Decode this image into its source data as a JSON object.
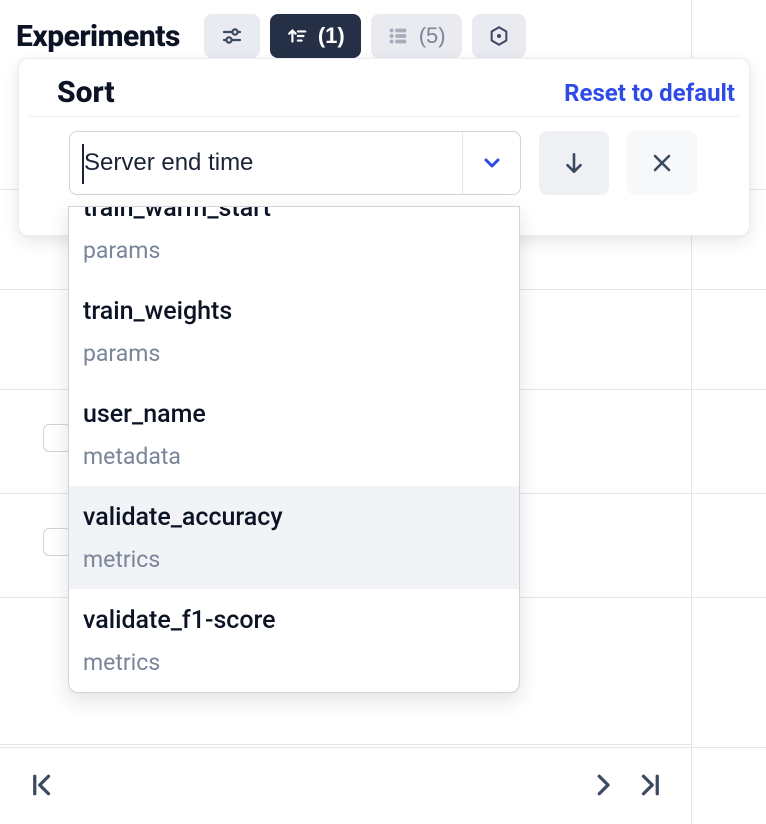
{
  "header": {
    "title": "Experiments",
    "tabs": {
      "sliders": {
        "label": ""
      },
      "sort": {
        "count": "(1)"
      },
      "group": {
        "count": "(5)"
      },
      "columns": {
        "label": ""
      }
    }
  },
  "sort_panel": {
    "title": "Sort",
    "reset_label": "Reset to default",
    "field_placeholder": "Server end time"
  },
  "options": [
    {
      "name": "train_warm_start",
      "category": "params"
    },
    {
      "name": "train_weights",
      "category": "params"
    },
    {
      "name": "user_name",
      "category": "metadata"
    },
    {
      "name": "validate_accuracy",
      "category": "metrics"
    },
    {
      "name": "validate_f1-score",
      "category": "metrics"
    }
  ]
}
